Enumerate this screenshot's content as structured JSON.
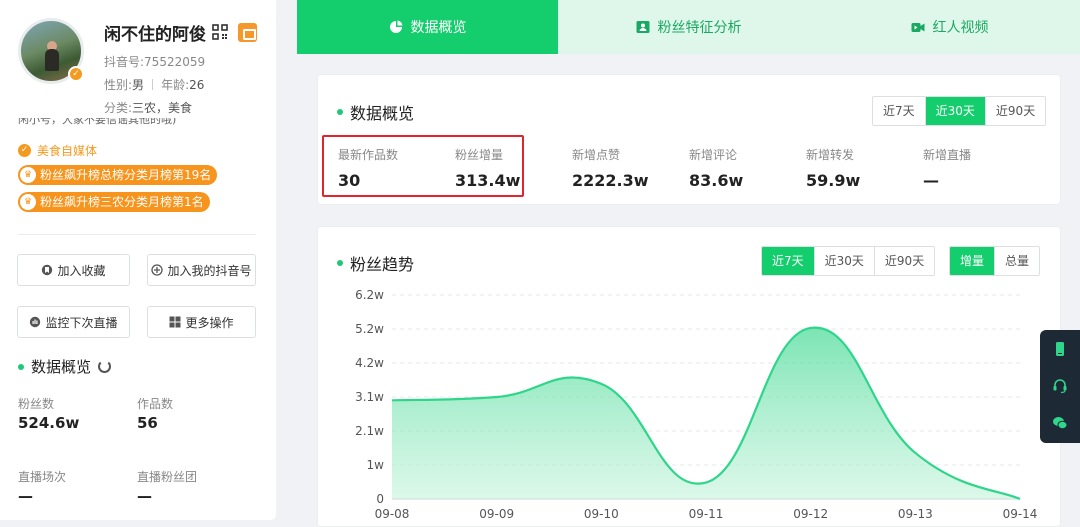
{
  "profile": {
    "name": "闲不住的阿俊",
    "douyin_id": "抖音号:75522059",
    "gender_label": "性别:",
    "gender": "男",
    "age_label": "年龄:",
    "age": "26",
    "category_label": "分类:",
    "category": "三农，美食",
    "bio": "闲小号，大家不要信谣其他的哦)",
    "tag": "美食自媒体",
    "ranks": [
      "粉丝飙升榜总榜分类月榜第19名",
      "粉丝飙升榜三农分类月榜第1名"
    ]
  },
  "actions": {
    "favorite": "加入收藏",
    "add_douyin": "加入我的抖音号",
    "monitor_live": "监控下次直播",
    "more": "更多操作"
  },
  "left_overview": {
    "title": "数据概览",
    "fans_label": "粉丝数",
    "fans": "524.6w",
    "works_label": "作品数",
    "works": "56",
    "live_label": "直播场次",
    "live": "—",
    "fan_group_label": "直播粉丝团",
    "fan_group": "—"
  },
  "tabs": [
    "数据概览",
    "粉丝特征分析",
    "红人视频"
  ],
  "overview": {
    "title": "数据概览",
    "ranges": [
      "近7天",
      "近30天",
      "近90天"
    ],
    "active_range": "近30天",
    "stats": [
      {
        "label": "最新作品数",
        "value": "30"
      },
      {
        "label": "粉丝增量",
        "value": "313.4w"
      },
      {
        "label": "新增点赞",
        "value": "2222.3w"
      },
      {
        "label": "新增评论",
        "value": "83.6w"
      },
      {
        "label": "新增转发",
        "value": "59.9w"
      },
      {
        "label": "新增直播",
        "value": "—"
      }
    ]
  },
  "trend": {
    "title": "粉丝趋势",
    "ranges": [
      "近7天",
      "近30天",
      "近90天"
    ],
    "modes": [
      "增量",
      "总量"
    ]
  },
  "colors": {
    "accent": "#14cd6c",
    "tab_bg": "#dff6ea",
    "orange": "#f7941d",
    "highlight": "#e2242e"
  },
  "chart_data": {
    "type": "area",
    "title": "粉丝趋势",
    "x": [
      "09-08",
      "09-09",
      "09-10",
      "09-11",
      "09-12",
      "09-13",
      "09-14"
    ],
    "y_ticks": [
      "0",
      "1w",
      "2.1w",
      "3.1w",
      "4.2w",
      "5.2w",
      "6.2w"
    ],
    "series": [
      {
        "values": [
          3.0,
          3.1,
          3.5,
          0.5,
          5.2,
          1.4,
          0.0
        ]
      }
    ],
    "ylim": [
      0,
      6.2
    ],
    "grid": true,
    "legend": "none",
    "color": "#2fd58a"
  }
}
